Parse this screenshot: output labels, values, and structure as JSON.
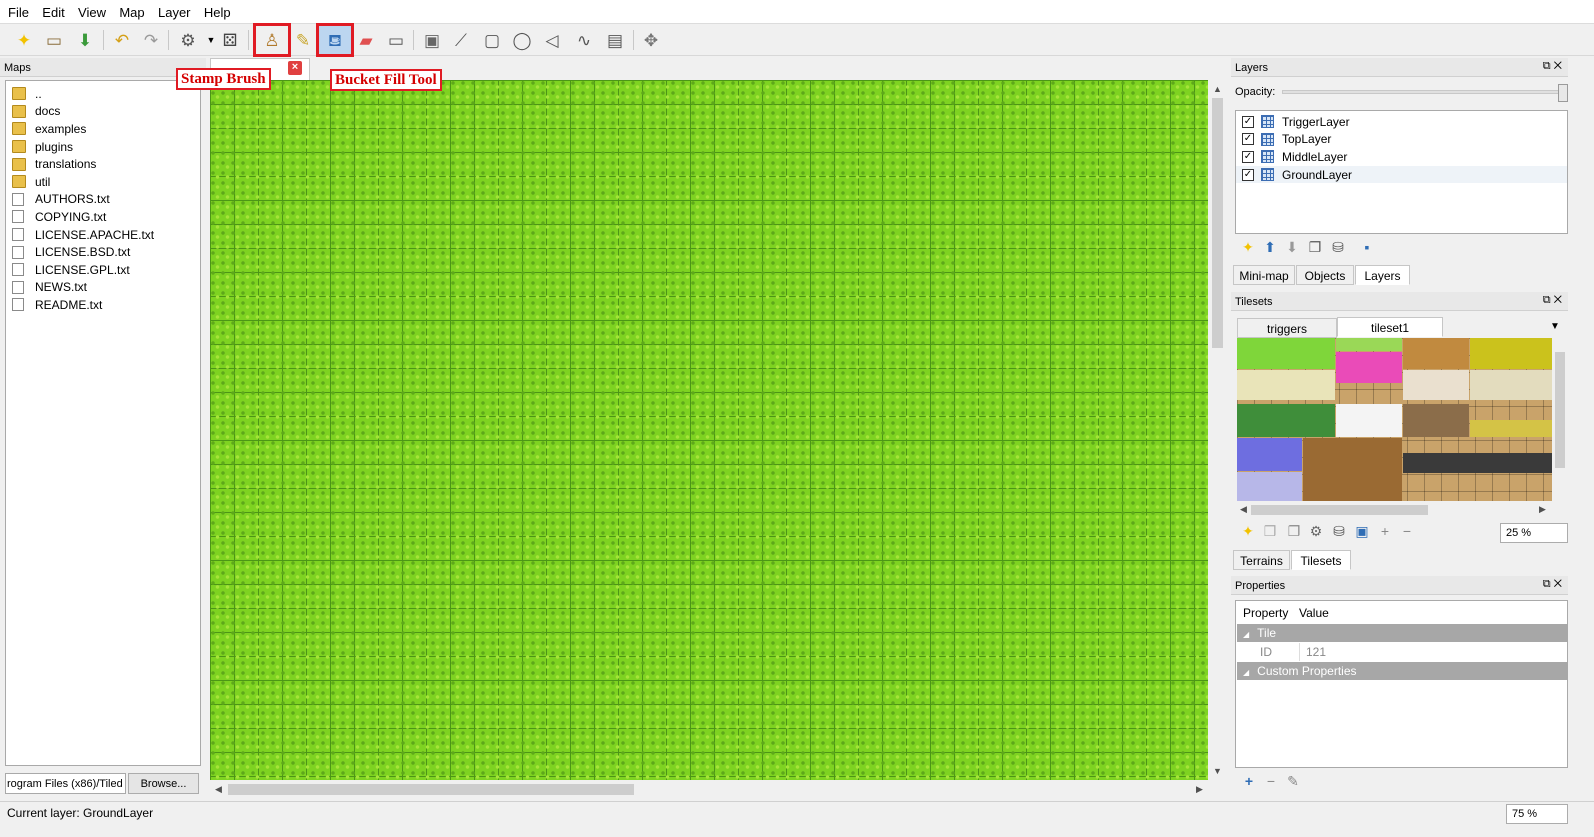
{
  "menu": [
    "File",
    "Edit",
    "View",
    "Map",
    "Layer",
    "Help"
  ],
  "toolbar": {
    "callouts": {
      "stamp": "Stamp Brush",
      "bucket": "Bucket Fill Tool"
    },
    "icons": [
      "new-icon",
      "open-icon",
      "save-icon",
      "undo-icon",
      "redo-icon",
      "commands-icon",
      "random-icon",
      "stamp-brush-icon",
      "terrain-brush-icon",
      "bucket-fill-icon",
      "eraser-icon",
      "rect-select-icon",
      "magic-wand-icon",
      "edit-polygon-icon",
      "rect-object-icon",
      "ellipse-object-icon",
      "polygon-object-icon",
      "polyline-object-icon",
      "tile-object-icon",
      "select-objects-icon"
    ]
  },
  "maps_panel": {
    "title": "Maps",
    "folders": [
      "..",
      "docs",
      "examples",
      "plugins",
      "translations",
      "util"
    ],
    "files": [
      "AUTHORS.txt",
      "COPYING.txt",
      "LICENSE.APACHE.txt",
      "LICENSE.BSD.txt",
      "LICENSE.GPL.txt",
      "NEWS.txt",
      "README.txt"
    ],
    "path_value": "rogram Files (x86)/Tiled",
    "browse_label": "Browse..."
  },
  "layers_panel": {
    "title": "Layers",
    "opacity_label": "Opacity:",
    "layers": [
      "TriggerLayer",
      "TopLayer",
      "MiddleLayer",
      "GroundLayer"
    ],
    "selected_layer": "GroundLayer",
    "tabs": [
      "Mini-map",
      "Objects",
      "Layers"
    ],
    "active_tab": "Layers"
  },
  "tilesets_panel": {
    "title": "Tilesets",
    "tabs": [
      "triggers",
      "tileset1"
    ],
    "active_tab": "tileset1",
    "zoom": "25 %",
    "bottom_tabs": [
      "Terrains",
      "Tilesets"
    ],
    "active_bottom_tab": "Tilesets"
  },
  "properties_panel": {
    "title": "Properties",
    "headers": [
      "Property",
      "Value"
    ],
    "group_tile": "Tile",
    "id_label": "ID",
    "id_value": "121",
    "group_custom": "Custom Properties"
  },
  "status": {
    "current_layer": "Current layer: GroundLayer",
    "zoom": "75 %"
  },
  "colors": {
    "grass": "#7ed321",
    "callout": "#e01b24",
    "highlight": "#bcd6f0"
  }
}
